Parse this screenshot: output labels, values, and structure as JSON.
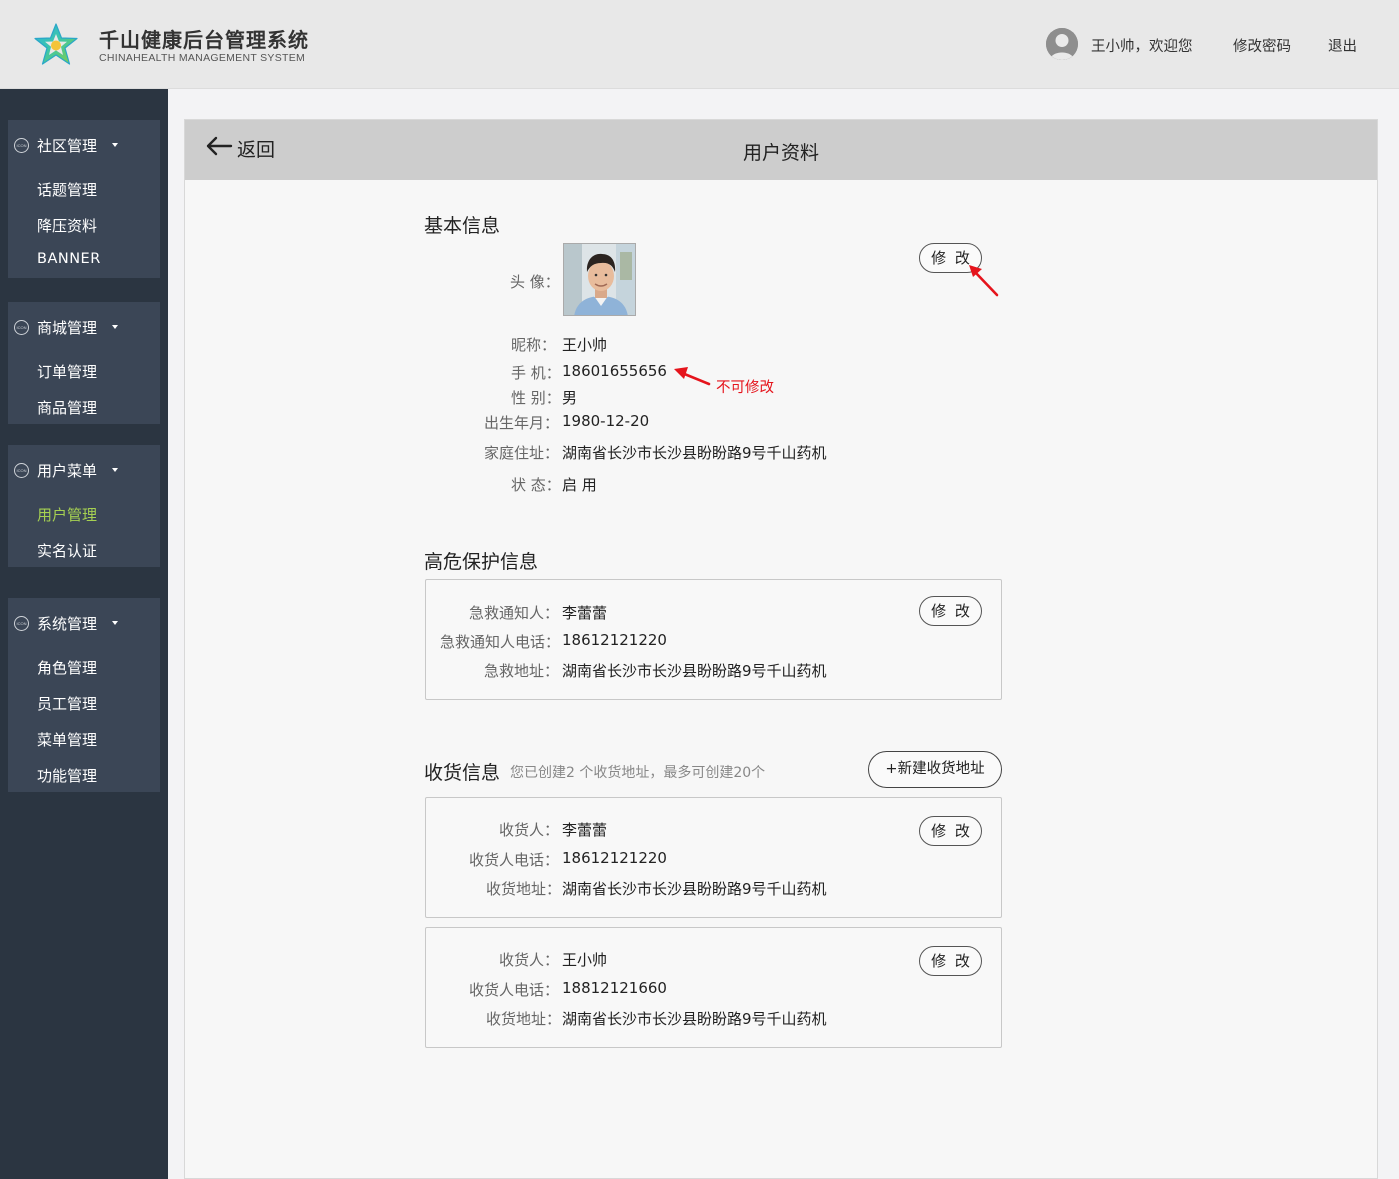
{
  "app": {
    "title": "千山健康后台管理系统",
    "subtitle": "CHINAHEALTH  MANAGEMENT SYSTEM"
  },
  "header": {
    "welcome": "王小帅，欢迎您",
    "change_password": "修改密码",
    "logout": "退出"
  },
  "sidebar": {
    "groups": [
      {
        "icon_text": "ICON",
        "label": "社区管理",
        "items": [
          "话题管理",
          "降压资料",
          "BANNER"
        ]
      },
      {
        "icon_text": "ICON",
        "label": "商城管理",
        "items": [
          "订单管理",
          "商品管理"
        ]
      },
      {
        "icon_text": "ICON",
        "label": "用户菜单",
        "items": [
          "用户管理",
          "实名认证"
        ]
      },
      {
        "icon_text": "ICON",
        "label": "系统管理",
        "items": [
          "角色管理",
          "员工管理",
          "菜单管理",
          "功能管理"
        ]
      }
    ],
    "active_item": "用户管理"
  },
  "page": {
    "back_label": "返回",
    "title": "用户资料"
  },
  "basic": {
    "section_title": "基本信息",
    "edit_label": "修 改",
    "avatar_label": "头 像：",
    "nickname_label": "昵称：",
    "nickname": "王小帅",
    "phone_label": "手 机：",
    "phone": "18601655656",
    "phone_note": "不可修改",
    "gender_label": "性 别：",
    "gender": "男",
    "birth_label": "出生年月：",
    "birth": "1980-12-20",
    "address_label": "家庭住址：",
    "address": "湖南省长沙市长沙县盼盼路9号千山药机",
    "status_label": "状 态：",
    "status": "启 用"
  },
  "emergency": {
    "section_title": "高危保护信息",
    "edit_label": "修 改",
    "contact_label": "急救通知人：",
    "contact": "李蕾蕾",
    "contact_phone_label": "急救通知人电话：",
    "contact_phone": "18612121220",
    "address_label": "急救地址：",
    "address": "湖南省长沙市长沙县盼盼路9号千山药机"
  },
  "shipping": {
    "section_title": "收货信息",
    "hint": "您已创建2 个收货地址，最多可创建20个",
    "new_button": "+新建收货地址",
    "edit_label": "修 改",
    "receiver_label": "收货人：",
    "phone_label": "收货人电话：",
    "address_label": "收货地址：",
    "addresses": [
      {
        "receiver": "李蕾蕾",
        "phone": "18612121220",
        "address": "湖南省长沙市长沙县盼盼路9号千山药机"
      },
      {
        "receiver": "王小帅",
        "phone": "18812121660",
        "address": "湖南省长沙市长沙县盼盼路9号千山药机"
      }
    ]
  },
  "colors": {
    "sidebar_bg": "#2b3541",
    "menu_group_bg": "#3b4656",
    "active_menu": "#a6d152",
    "annotation_red": "#e5141c",
    "header_bg": "#e8e8e8",
    "panel_header_bg": "#cdcdcd"
  },
  "icons": {
    "logo": "star-logo-icon",
    "user_avatar": "user-avatar-icon",
    "back": "arrow-left-icon",
    "menu": "icon-placeholder-circle",
    "caret": "caret-down-icon"
  }
}
